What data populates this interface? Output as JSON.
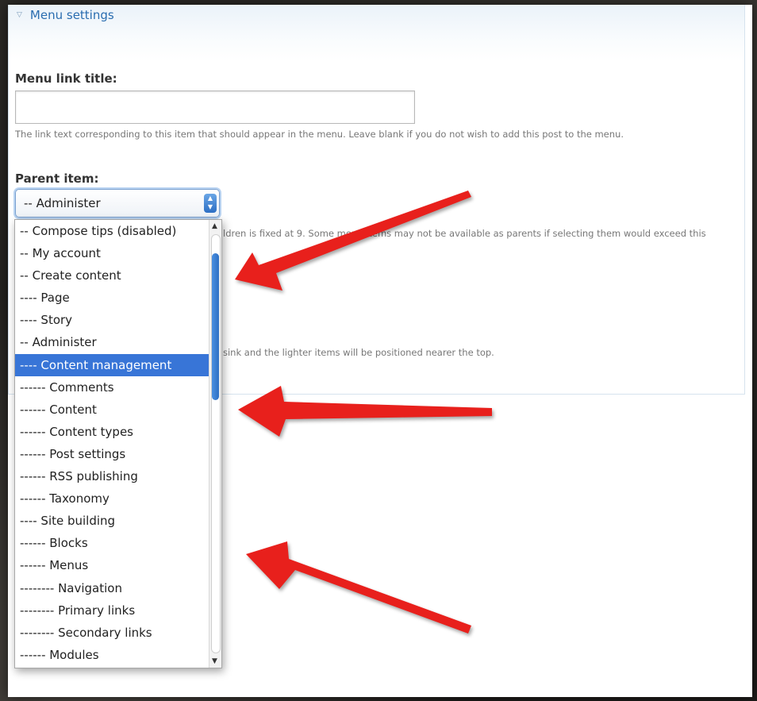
{
  "fieldset": {
    "legend": "Menu settings",
    "menu_link_title_label": "Menu link title:",
    "menu_link_title_value": "",
    "menu_link_title_desc": "The link text corresponding to this item that should appear in the menu. Leave blank if you do not wish to add this post to the menu.",
    "parent_item_label": "Parent item:",
    "parent_item_selected": "-- Administer",
    "parent_desc_visible": "ldren is fixed at 9. Some menu items may not be available as parents if selecting them would exceed this",
    "weight_desc_visible": "sink and the lighter items will be positioned nearer the top."
  },
  "dropdown": {
    "items": [
      "-- Compose tips (disabled)",
      "-- My account",
      "-- Create content",
      "---- Page",
      "---- Story",
      "-- Administer",
      "---- Content management",
      "------ Comments",
      "------ Content",
      "------ Content types",
      "------ Post settings",
      "------ RSS publishing",
      "------ Taxonomy",
      "---- Site building",
      "------ Blocks",
      "------ Menus",
      "-------- Navigation",
      "-------- Primary links",
      "-------- Secondary links",
      "------ Modules"
    ],
    "highlighted_index": 6
  },
  "colors": {
    "accent": "#3875d7",
    "legend_link": "#2a6db0",
    "annotation_arrow": "#e8201c"
  },
  "icons": {
    "legend_toggle": "triangle-down-icon",
    "select_stepper": "up-down-stepper-icon"
  }
}
